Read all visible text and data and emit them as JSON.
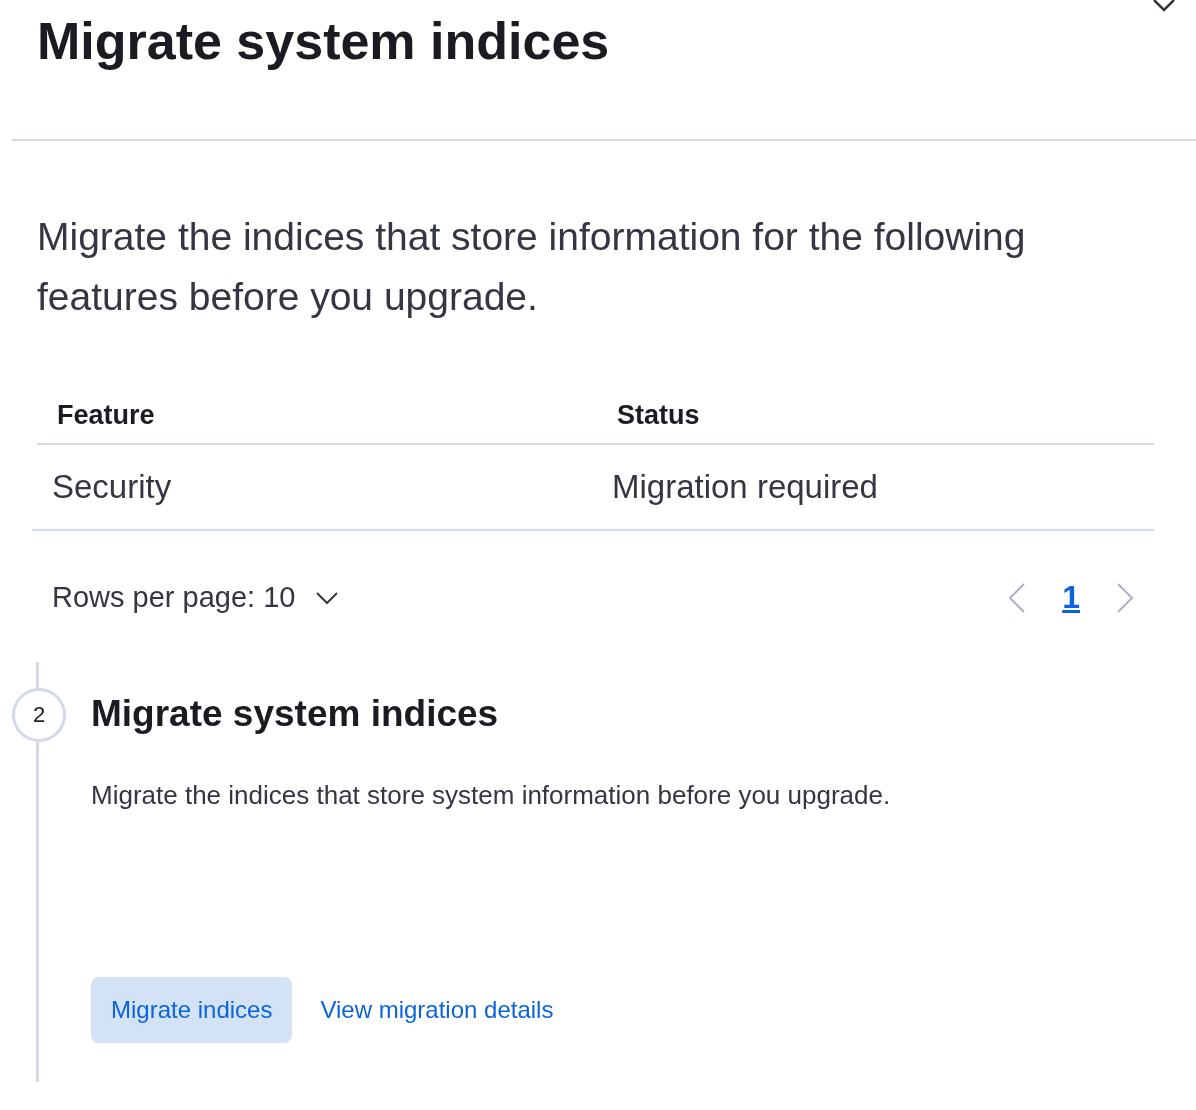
{
  "flyout": {
    "title": "Migrate system indices"
  },
  "intro": "Migrate the indices that store information for the following features before you upgrade.",
  "table": {
    "columns": [
      "Feature",
      "Status"
    ],
    "rows": [
      {
        "cells": [
          "Security",
          "Migration required"
        ]
      }
    ]
  },
  "pagination": {
    "rows_per_page": "Rows per page: 10",
    "pages": [
      {
        "label": "1",
        "selected": true
      }
    ]
  },
  "step": {
    "number": "2",
    "title": "Migrate system indices",
    "description": "Migrate the indices that store system information before you upgrade.",
    "buttons": [
      {
        "label": "Migrate indices",
        "kind": "filled"
      },
      {
        "label": "View migration details",
        "kind": "link"
      }
    ]
  }
}
